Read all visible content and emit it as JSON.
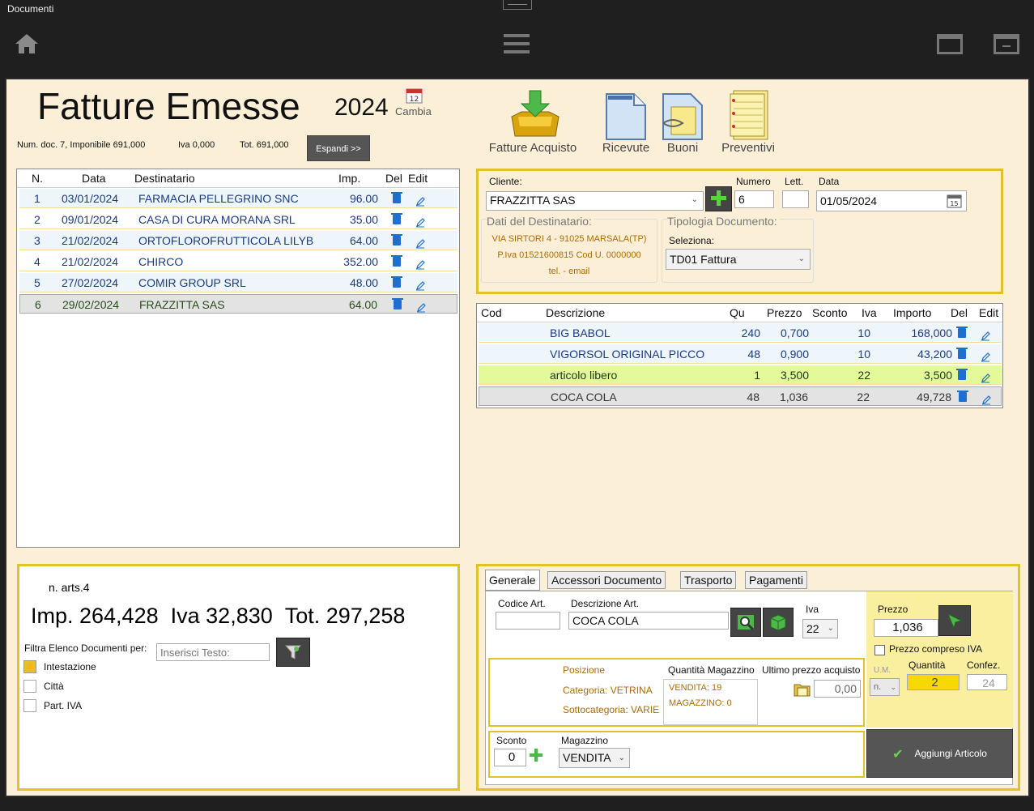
{
  "window": {
    "title": "Documenti"
  },
  "header": {
    "title": "Fatture Emesse",
    "year": "2024",
    "cambia": "Cambia",
    "calendar_day": "12",
    "num_doc": "Num. doc. 7, Imponibile 691,000",
    "iva": "Iva 0,000",
    "tot": "Tot. 691,000",
    "espandi": "Espandi >>"
  },
  "toolbar": [
    {
      "label": "Fatture Acquisto"
    },
    {
      "label": "Ricevute"
    },
    {
      "label": "Buoni"
    },
    {
      "label": "Preventivi"
    }
  ],
  "doc_list": {
    "headers": [
      "N.",
      "Data",
      "Destinatario",
      "Imp.",
      "Del",
      "Edit"
    ],
    "rows": [
      {
        "n": "1",
        "data": "03/01/2024",
        "dest": "FARMACIA PELLEGRINO SNC",
        "imp": "96.00"
      },
      {
        "n": "2",
        "data": "09/01/2024",
        "dest": "CASA DI CURA MORANA SRL",
        "imp": "35.00"
      },
      {
        "n": "3",
        "data": "21/02/2024",
        "dest": "ORTOFLOROFRUTTICOLA LILYB",
        "imp": "64.00"
      },
      {
        "n": "4",
        "data": "21/02/2024",
        "dest": "CHIRCO",
        "imp": "352.00"
      },
      {
        "n": "5",
        "data": "27/02/2024",
        "dest": "COMIR GROUP SRL",
        "imp": "48.00"
      },
      {
        "n": "6",
        "data": "29/02/2024",
        "dest": "FRAZZITTA SAS",
        "imp": "64.00"
      }
    ]
  },
  "summary": {
    "n_arts": "n. arts.4",
    "imp": "Imp. 264,428",
    "iva": "Iva 32,830",
    "tot": "Tot. 297,258",
    "filtra": "Filtra Elenco Documenti per:",
    "search_placeholder": "Inserisci Testo:",
    "filters": [
      "Intestazione",
      "Città",
      "Part. IVA"
    ]
  },
  "doc_head": {
    "cliente_label": "Cliente:",
    "cliente": "FRAZZITTA SAS",
    "numero_label": "Numero",
    "numero": "6",
    "lett_label": "Lett.",
    "lett": "",
    "data_label": "Data",
    "data": "01/05/2024",
    "calendar_day": "15",
    "dati_label": "Dati del Destinatario:",
    "addr1": "VIA SIRTORI 4 - 91025 MARSALA(TP)",
    "addr2": "P.Iva 01521600815 Cod U. 0000000",
    "addr3": "tel.  - email",
    "tipologia_label": "Tipologia Documento:",
    "seleziona": "Seleziona:",
    "tipologia": "TD01 Fattura"
  },
  "articles": {
    "headers": [
      "Cod",
      "Descrizione",
      "Qu",
      "Prezzo",
      "Sconto",
      "Iva",
      "Importo",
      "Del",
      "Edit"
    ],
    "rows": [
      {
        "desc": "BIG BABOL",
        "qu": "240",
        "prezzo": "0,700",
        "sconto": "",
        "iva": "10",
        "importo": "168,000"
      },
      {
        "desc": "VIGORSOL ORIGINAL PICCO",
        "qu": "48",
        "prezzo": "0,900",
        "sconto": "",
        "iva": "10",
        "importo": "43,200"
      },
      {
        "desc": "articolo libero",
        "qu": "1",
        "prezzo": "3,500",
        "sconto": "",
        "iva": "22",
        "importo": "3,500"
      },
      {
        "desc": "COCA COLA",
        "qu": "48",
        "prezzo": "1,036",
        "sconto": "",
        "iva": "22",
        "importo": "49,728"
      }
    ]
  },
  "editor": {
    "tabs": [
      "Generale",
      "Accessori Documento",
      "Trasporto",
      "Pagamenti"
    ],
    "codice_label": "Codice Art.",
    "codice": "",
    "descr_label": "Descrizione Art.",
    "descr": "COCA COLA",
    "iva_label": "Iva",
    "iva": "22",
    "prezzo_label": "Prezzo",
    "prezzo": "1,036",
    "compreso_label": "Prezzo compreso IVA",
    "um_label": "U.M.",
    "um": "n.",
    "quantita_label": "Quantità",
    "quantita": "2",
    "confez_label": "Confez.",
    "confez": "24",
    "posizione": "Posizione",
    "categoria": "Categoria: VETRINA",
    "sottocategoria": "Sottocategoria: VARIE",
    "qmag_label": "Quantità Magazzino",
    "vendita": "VENDITA: 19",
    "magazzino_q": "MAGAZZINO: 0",
    "ultimo_label": "Ultimo prezzo acquisto",
    "ultimo": "0,00",
    "sconto_label": "Sconto",
    "sconto": "0",
    "magazzino_label": "Magazzino",
    "magazzino": "VENDITA",
    "aggiungi": "Aggiungi Articolo"
  },
  "colors": {
    "accent": "#e2c226",
    "background": "#fbf0d7",
    "link": "#1a3a8a",
    "highlight": "#e4f99a"
  }
}
